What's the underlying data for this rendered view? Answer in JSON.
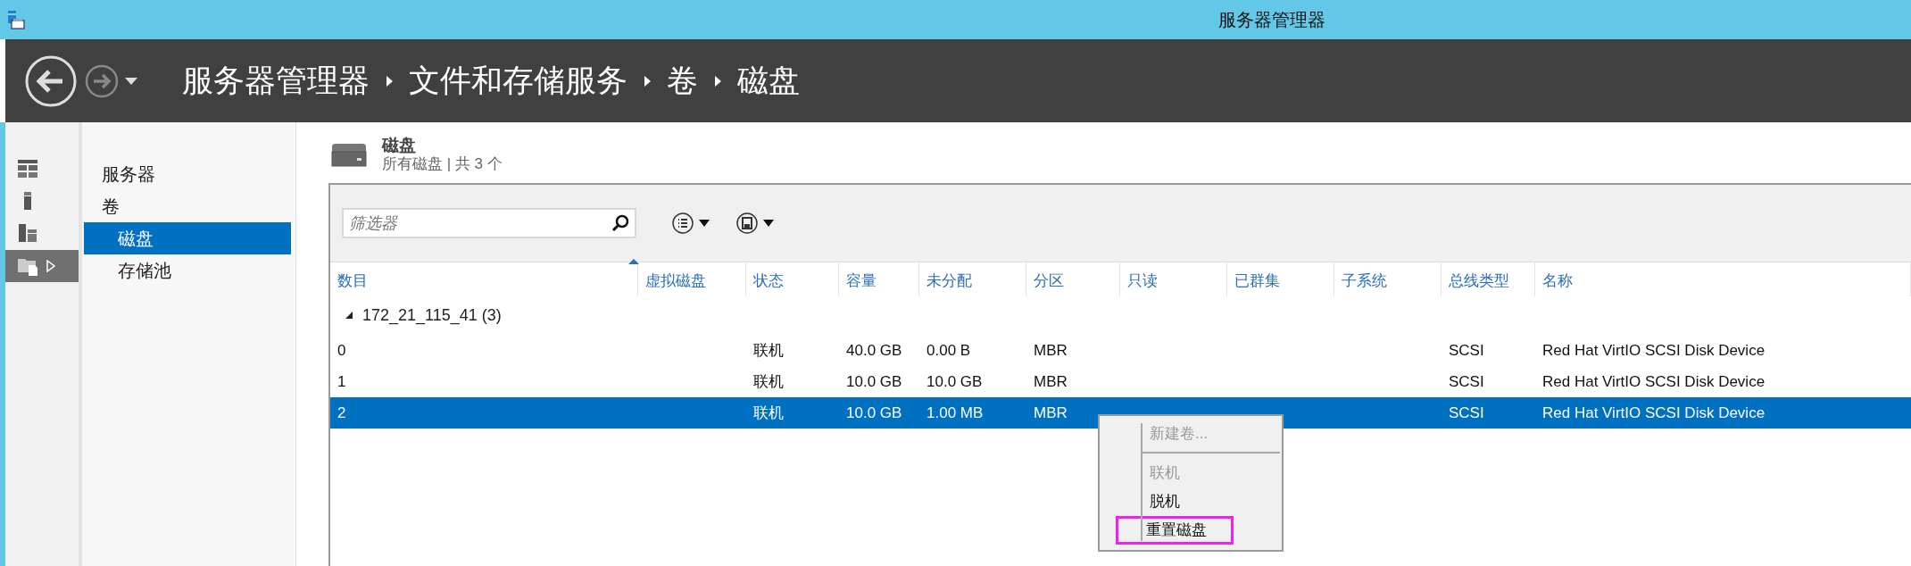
{
  "window": {
    "title": "服务器管理器"
  },
  "breadcrumb": [
    "服务器管理器",
    "文件和存储服务",
    "卷",
    "磁盘"
  ],
  "icon_sidebar": [
    {
      "kind": "dashboard",
      "selected": false
    },
    {
      "kind": "server",
      "selected": false
    },
    {
      "kind": "servers",
      "selected": false
    },
    {
      "kind": "files",
      "selected": true
    }
  ],
  "nav": [
    {
      "label": "服务器",
      "selected": false
    },
    {
      "label": "卷",
      "selected": false,
      "children": [
        {
          "label": "磁盘",
          "selected": true
        },
        {
          "label": "存储池",
          "selected": false
        }
      ]
    }
  ],
  "section": {
    "title": "磁盘",
    "subtitle": "所有磁盘 | 共 3 个"
  },
  "filter": {
    "placeholder": "筛选器"
  },
  "table": {
    "columns": [
      {
        "label": "数目",
        "sorted": true
      },
      {
        "label": "虚拟磁盘",
        "sorted": false
      },
      {
        "label": "状态",
        "sorted": false
      },
      {
        "label": "容量",
        "sorted": false
      },
      {
        "label": "未分配",
        "sorted": false
      },
      {
        "label": "分区",
        "sorted": false
      },
      {
        "label": "只读",
        "sorted": false
      },
      {
        "label": "已群集",
        "sorted": false
      },
      {
        "label": "子系统",
        "sorted": false
      },
      {
        "label": "总线类型",
        "sorted": false
      },
      {
        "label": "名称",
        "sorted": false
      }
    ],
    "groups": [
      {
        "label": "172_21_115_41 (3)",
        "expanded": true,
        "rows": [
          {
            "selected": false,
            "cells": [
              "0",
              null,
              "联机",
              "40.0 GB",
              "0.00 B",
              "MBR",
              null,
              null,
              null,
              "SCSI",
              "Red Hat VirtIO SCSI Disk Device"
            ]
          },
          {
            "selected": false,
            "cells": [
              "1",
              null,
              "联机",
              "10.0 GB",
              "10.0 GB",
              "MBR",
              null,
              null,
              null,
              "SCSI",
              "Red Hat VirtIO SCSI Disk Device"
            ]
          },
          {
            "selected": true,
            "cells": [
              "2",
              null,
              "联机",
              "10.0 GB",
              "1.00 MB",
              "MBR",
              null,
              null,
              null,
              "SCSI",
              "Red Hat VirtIO SCSI Disk Device"
            ]
          }
        ]
      }
    ]
  },
  "context_menu": {
    "items": [
      {
        "kind": "item",
        "label": "新建卷...",
        "disabled": true,
        "highlighted": false
      },
      {
        "kind": "separator"
      },
      {
        "kind": "item",
        "label": "联机",
        "disabled": true,
        "highlighted": false
      },
      {
        "kind": "item",
        "label": "脱机",
        "disabled": false,
        "highlighted": false
      },
      {
        "kind": "item",
        "label": "重置磁盘",
        "disabled": false,
        "highlighted": true
      }
    ]
  }
}
